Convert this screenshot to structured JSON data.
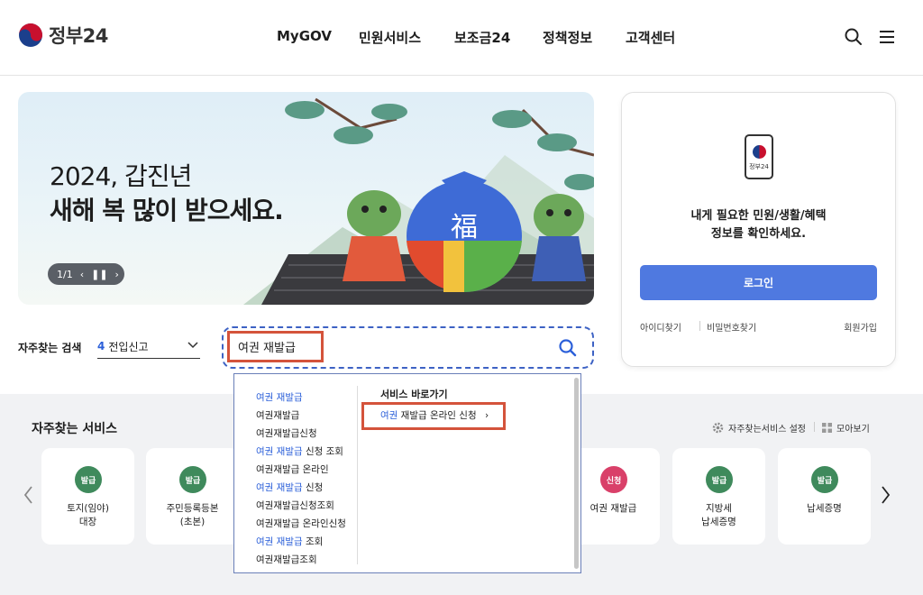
{
  "header": {
    "logo_text": "정부24",
    "nav": [
      "MyGOV",
      "민원서비스",
      "보조금24",
      "정책정보",
      "고객센터"
    ],
    "icons": [
      "search-icon",
      "menu-icon"
    ]
  },
  "banner": {
    "line1": "2024, 갑진년",
    "line2": "새해 복 많이 받으세요.",
    "pager": "1/1",
    "bag_char": "福"
  },
  "login": {
    "app_label": "정부24",
    "message_line1": "내게 필요한 민원/생활/혜택",
    "message_line2": "정보를 확인하세요.",
    "button": "로그인",
    "find_id": "아이디찾기",
    "find_pw": "비밀번호찾기",
    "signup": "회원가입"
  },
  "search": {
    "label": "자주찾는 검색",
    "popular_rank": "4",
    "popular_term": "전입신고",
    "input_value": "여권 재발급"
  },
  "suggestions": {
    "items": [
      {
        "hl": "여권 재발급",
        "rest": ""
      },
      {
        "hl": "",
        "rest": "여권재발급"
      },
      {
        "hl": "",
        "rest": "여권재발급신청"
      },
      {
        "hl": "여권 재발급",
        "rest": " 신청 조회"
      },
      {
        "hl": "",
        "rest": "여권재발급 온라인"
      },
      {
        "hl": "여권 재발급",
        "rest": " 신청"
      },
      {
        "hl": "",
        "rest": "여권재발급신청조회"
      },
      {
        "hl": "",
        "rest": "여권재발급 온라인신청"
      },
      {
        "hl": "여권 재발급",
        "rest": " 조회"
      },
      {
        "hl": "",
        "rest": "여권재발급조회"
      }
    ],
    "shortcut_title": "서비스 바로가기",
    "shortcut_hl": "여권",
    "shortcut_rest": " 재발급 온라인 신청",
    "shortcut_chevron": "›"
  },
  "frequent": {
    "title": "자주찾는 서비스",
    "settings": "자주찾는서비스 설정",
    "view_all": "모아보기",
    "cards": [
      {
        "badge": "발급",
        "color": "#3f8a5c",
        "name": "토지(임야)\n대장"
      },
      {
        "badge": "발급",
        "color": "#3f8a5c",
        "name": "주민등록등본\n(초본)"
      },
      {
        "badge": "신청",
        "color": "#d94069",
        "name": "여권 재발급"
      },
      {
        "badge": "발급",
        "color": "#3f8a5c",
        "name": "지방세\n납세증명"
      },
      {
        "badge": "발급",
        "color": "#3f8a5c",
        "name": "납세증명"
      }
    ]
  },
  "colors": {
    "brand_blue": "#4f79e0",
    "highlight_blue": "#2b5fd9",
    "annotation_red": "#d4533b"
  }
}
